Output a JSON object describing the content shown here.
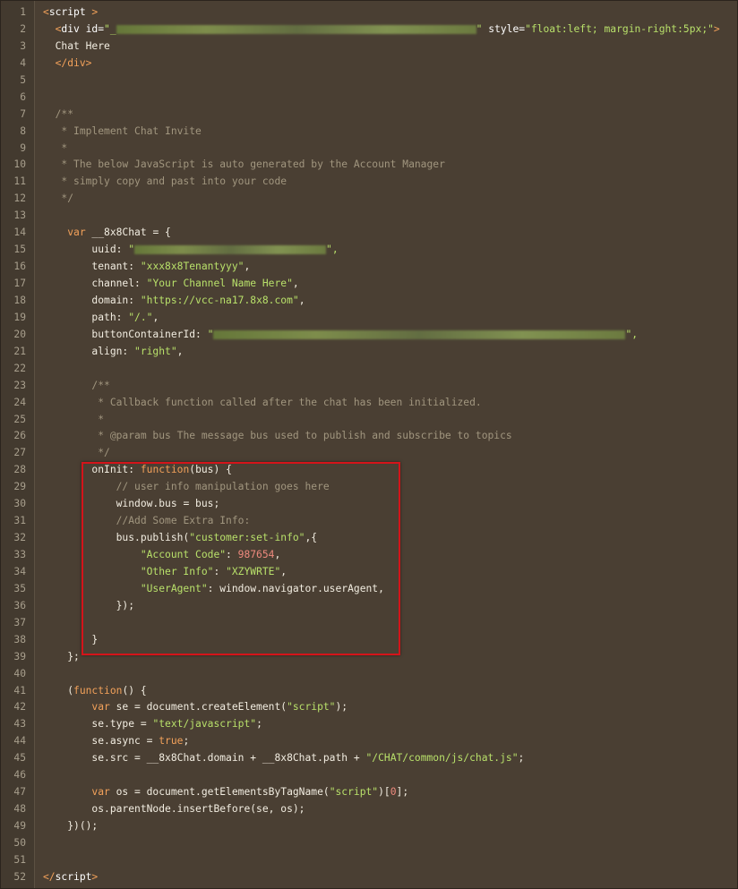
{
  "line_numbers": [
    "1",
    "2",
    "3",
    "4",
    "5",
    "6",
    "7",
    "8",
    "9",
    "10",
    "11",
    "12",
    "13",
    "14",
    "15",
    "16",
    "17",
    "18",
    "19",
    "20",
    "21",
    "22",
    "23",
    "24",
    "25",
    "26",
    "27",
    "28",
    "29",
    "30",
    "31",
    "32",
    "33",
    "34",
    "35",
    "36",
    "37",
    "38",
    "39",
    "40",
    "41",
    "42",
    "43",
    "44",
    "45",
    "46",
    "47",
    "48",
    "49",
    "50",
    "51",
    "52"
  ],
  "code": {
    "l1_open": "<",
    "l1_tag": "script",
    "l1_close": " >",
    "l2_open": "<",
    "l2_tag": "div",
    "l2_id_attr": " id=",
    "l2_id_val_start": "\"_",
    "l2_id_val_end": "\"",
    "l2_style_attr": " style=",
    "l2_style_val": "\"float:left; margin-right:5px;\"",
    "l2_end": ">",
    "l3": "Chat Here",
    "l4": "</div>",
    "l7": "/**",
    "l8": " * Implement Chat Invite",
    "l9": " *",
    "l10": " * The below JavaScript is auto generated by the Account Manager",
    "l11": " * simply copy and past into your code",
    "l12": " */",
    "l14_kw": "var",
    "l14_rest": " __8x8Chat = {",
    "l15_key": "uuid: ",
    "l15_q1": "\"",
    "l15_q2": "\",",
    "l16_key": "tenant: ",
    "l16_val": "\"xxx8x8Tenantyyy\"",
    "l16_end": ",",
    "l17_key": "channel: ",
    "l17_val": "\"Your Channel Name Here\"",
    "l17_end": ",",
    "l18_key": "domain: ",
    "l18_val": "\"https://vcc-na17.8x8.com\"",
    "l18_end": ",",
    "l19_key": "path: ",
    "l19_val": "\"/.\"",
    "l19_end": ",",
    "l20_key": "buttonContainerId: ",
    "l20_q1": "\"",
    "l20_q2": "\",",
    "l21_key": "align: ",
    "l21_val": "\"right\"",
    "l21_end": ",",
    "l23": "/**",
    "l24": " * Callback function called after the chat has been initialized.",
    "l25": " *",
    "l26": " * @param bus The message bus used to publish and subscribe to topics",
    "l27": " */",
    "l28_key": "onInit: ",
    "l28_kw": "function",
    "l28_rest": "(bus) {",
    "l29": "// user info manipulation goes here",
    "l30": "window.bus = bus;",
    "l31": "//Add Some Extra Info:",
    "l32_a": "bus.publish(",
    "l32_str": "\"customer:set-info\"",
    "l32_b": ",{",
    "l33_key": "\"Account Code\"",
    "l33_sep": ": ",
    "l33_num": "987654",
    "l33_end": ",",
    "l34_key": "\"Other Info\"",
    "l34_sep": ": ",
    "l34_val": "\"XZYWRTE\"",
    "l34_end": ",",
    "l35_key": "\"UserAgent\"",
    "l35_rest": ": window.navigator.userAgent,",
    "l36": "});",
    "l38": "}",
    "l39": "};",
    "l41_a": "(",
    "l41_kw": "function",
    "l41_b": "() {",
    "l42_kw": "var",
    "l42_a": " se = document.createElement(",
    "l42_str": "\"script\"",
    "l42_b": ");",
    "l43_a": "se.type = ",
    "l43_str": "\"text/javascript\"",
    "l43_b": ";",
    "l44_a": "se.async = ",
    "l44_kw": "true",
    "l44_b": ";",
    "l45_a": "se.src = __8x8Chat.domain + __8x8Chat.path + ",
    "l45_str": "\"/CHAT/common/js/chat.js\"",
    "l45_b": ";",
    "l47_kw": "var",
    "l47_a": " os = document.getElementsByTagName(",
    "l47_str": "\"script\"",
    "l47_b": ")[",
    "l47_num": "0",
    "l47_c": "];",
    "l48": "os.parentNode.insertBefore(se, os);",
    "l49": "})();",
    "l52_open": "</",
    "l52_tag": "script",
    "l52_close": ">"
  },
  "colors": {
    "background": "#4a3f33",
    "string": "#b8e06a",
    "comment": "#a1967f",
    "keyword": "#f2a15a",
    "number": "#ef8a7e",
    "highlight_box": "#d4141a"
  }
}
